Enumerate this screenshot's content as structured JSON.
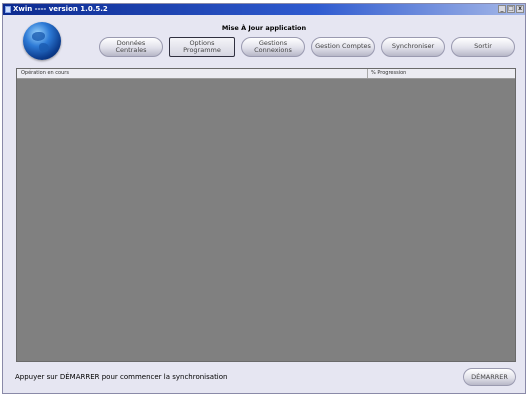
{
  "window": {
    "title": "Xwin ---- version 1.0.5.2",
    "controls": {
      "minimize": "_",
      "restore": "□",
      "close": "x"
    }
  },
  "header": {
    "title": "Mise À Jour application"
  },
  "toolbar": {
    "buttons": [
      {
        "line1": "Données",
        "line2": "Centrales"
      },
      {
        "line1": "Options",
        "line2": "Programme"
      },
      {
        "line1": "Gestions",
        "line2": "Connexions"
      },
      {
        "line1": "Gestion Comptes",
        "line2": ""
      },
      {
        "line1": "Synchroniser",
        "line2": ""
      },
      {
        "line1": "Sortir",
        "line2": ""
      }
    ],
    "active_index": 1
  },
  "list": {
    "columns": [
      "Opération en cours",
      "% Progression"
    ],
    "rows": []
  },
  "status": {
    "text": "Appuyer sur DÉMARRER pour commencer la synchronisation"
  },
  "start_button": {
    "label": "DÉMARRER"
  },
  "colors": {
    "window_bg": "#e6e6f2",
    "titlebar": "#0c2a8f",
    "list_bg": "#808080"
  },
  "icons": {
    "logo": "globe-icon"
  }
}
